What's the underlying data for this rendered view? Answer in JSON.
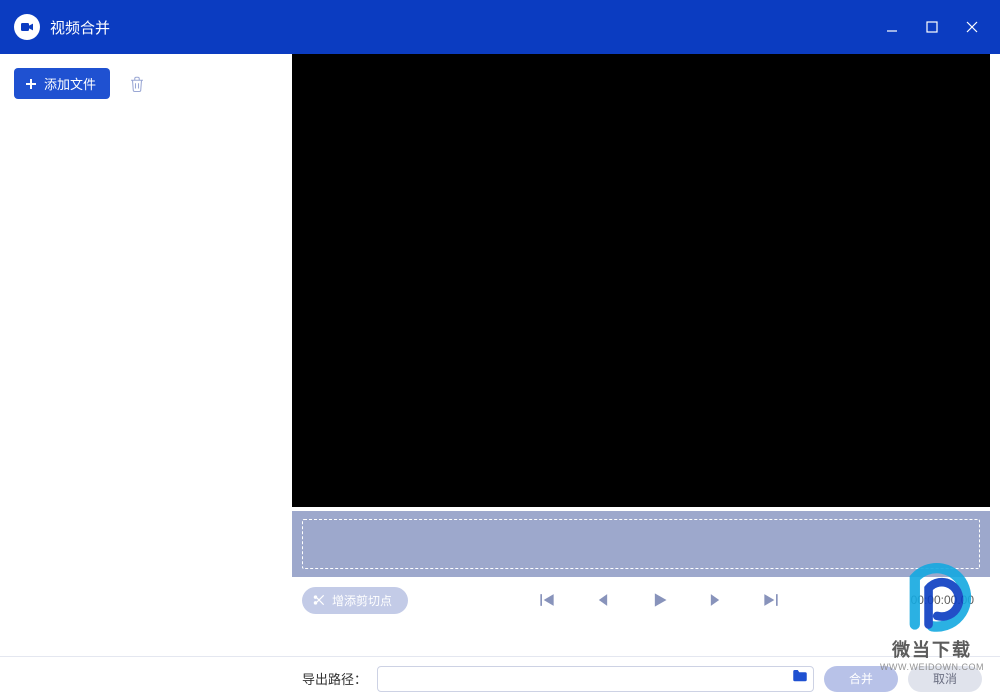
{
  "titlebar": {
    "title": "视频合并"
  },
  "sidebar": {
    "add_label": "添加文件"
  },
  "controls": {
    "cut_label": "增添剪切点",
    "time": "00:00:00.00"
  },
  "footer": {
    "path_label": "导出路径：",
    "path_value": "",
    "merge_label": "合并",
    "cancel_label": "取消"
  },
  "watermark": {
    "line1": "微当下载",
    "line2": "WWW.WEIDOWN.COM"
  }
}
